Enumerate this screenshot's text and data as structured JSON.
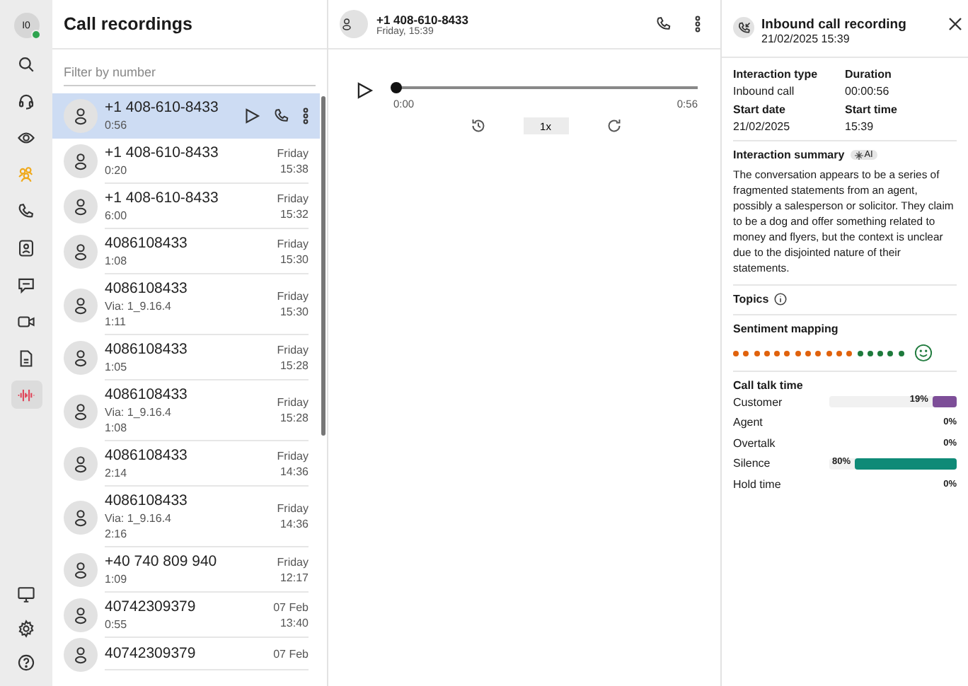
{
  "rail": {
    "avatar": {
      "initials": "I0",
      "online": true
    },
    "items": [
      {
        "kind": "search",
        "selected": false
      },
      {
        "kind": "headset",
        "selected": false
      },
      {
        "kind": "eye",
        "selected": false
      },
      {
        "kind": "people",
        "selected": false
      },
      {
        "kind": "phone",
        "selected": false
      },
      {
        "kind": "contact",
        "selected": false
      },
      {
        "kind": "chat",
        "selected": false
      },
      {
        "kind": "video",
        "selected": false
      },
      {
        "kind": "document",
        "selected": false
      },
      {
        "kind": "recording",
        "selected": true
      }
    ],
    "bottom": [
      {
        "kind": "monitor"
      },
      {
        "kind": "gear"
      },
      {
        "kind": "help"
      }
    ]
  },
  "list": {
    "title": "Call recordings",
    "filter": {
      "placeholder": "Filter by number"
    },
    "rows": [
      {
        "number": "+1 408-610-8433",
        "duration": "0:56",
        "selected": true
      },
      {
        "number": "+1 408-610-8433",
        "duration": "0:20",
        "day": "Friday",
        "time": "15:38",
        "selected": false
      },
      {
        "number": "+1 408-610-8433",
        "duration": "6:00",
        "day": "Friday",
        "time": "15:32",
        "selected": false
      },
      {
        "number": "4086108433",
        "duration": "1:08",
        "day": "Friday",
        "time": "15:30",
        "selected": false
      },
      {
        "number": "4086108433",
        "via": "Via: 1_9.16.4",
        "duration": "1:11",
        "day": "Friday",
        "time": "15:30",
        "selected": false
      },
      {
        "number": "4086108433",
        "duration": "1:05",
        "day": "Friday",
        "time": "15:28",
        "selected": false
      },
      {
        "number": "4086108433",
        "via": "Via: 1_9.16.4",
        "duration": "1:08",
        "day": "Friday",
        "time": "15:28",
        "selected": false
      },
      {
        "number": "4086108433",
        "duration": "2:14",
        "day": "Friday",
        "time": "14:36",
        "selected": false
      },
      {
        "number": "4086108433",
        "via": "Via: 1_9.16.4",
        "duration": "2:16",
        "day": "Friday",
        "time": "14:36",
        "selected": false
      },
      {
        "number": "+40 740 809 940",
        "duration": "1:09",
        "day": "Friday",
        "time": "12:17",
        "selected": false
      },
      {
        "number": "40742309379",
        "duration": "0:55",
        "day": "07 Feb",
        "time": "13:40",
        "selected": false
      },
      {
        "number": "40742309379",
        "day": "07 Feb",
        "selected": false
      }
    ]
  },
  "player": {
    "number": "+1 408-610-8433",
    "subtitle": "Friday, 15:39",
    "level": 0,
    "start": "0:00",
    "end": "0:56",
    "speed": "1x"
  },
  "details": {
    "title": "Inbound call recording",
    "date": "21/02/2025 15:39",
    "fields": [
      {
        "label": "Interaction type",
        "value": "Inbound call"
      },
      {
        "label": "Duration",
        "value": "00:00:56"
      },
      {
        "label": "Start date",
        "value": "21/02/2025"
      },
      {
        "label": "Start time",
        "value": "15:39"
      }
    ],
    "summary_title": "Interaction summary",
    "ai_badge": "AI",
    "summary": "The conversation appears to be a series of fragmented statements from an agent, possibly a salesperson or solicitor. They claim to be a dog and offer something related to money and flyers, but the context is unclear due to the disjointed nature of their statements.",
    "topics": "Topics",
    "sentiment_title": "Sentiment mapping",
    "sentiment": [
      {
        "color": "#e0620d"
      },
      {
        "color": "#e0620d"
      },
      {
        "color": "#e0620d"
      },
      {
        "color": "#e0620d"
      },
      {
        "color": "#e0620d"
      },
      {
        "color": "#e0620d"
      },
      {
        "color": "#e0620d"
      },
      {
        "color": "#e0620d"
      },
      {
        "color": "#e0620d"
      },
      {
        "color": "#e0620d"
      },
      {
        "color": "#e0620d"
      },
      {
        "color": "#e0620d"
      },
      {
        "color": "#1e7a3c"
      },
      {
        "color": "#1e7a3c"
      },
      {
        "color": "#1e7a3c"
      },
      {
        "color": "#1e7a3c"
      },
      {
        "color": "#1e7a3c"
      }
    ],
    "talk_title": "Call talk time",
    "talk": [
      {
        "label": "Customer",
        "reading": "19%",
        "level": 0.19,
        "color": "#7d4e98"
      },
      {
        "label": "Agent",
        "reading": "0%"
      },
      {
        "label": "Overtalk",
        "reading": "0%"
      },
      {
        "label": "Silence",
        "reading": "80%",
        "level": 0.8,
        "color": "#0f8a77"
      },
      {
        "label": "Hold time",
        "reading": "0%"
      }
    ]
  }
}
